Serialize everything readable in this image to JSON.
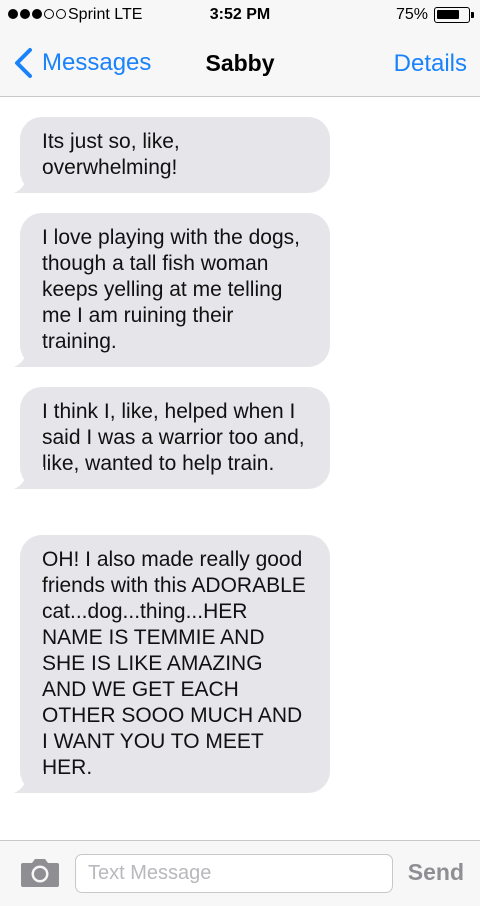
{
  "status_bar": {
    "signal_bars_filled": 3,
    "signal_bars_total": 5,
    "carrier": "Sprint  LTE",
    "time": "3:52 PM",
    "battery_percent_label": "75%",
    "battery_level": 0.75
  },
  "nav": {
    "back_label": "Messages",
    "title": "Sabby",
    "details_label": "Details"
  },
  "messages": [
    {
      "text": "Its just so, like, overwhelming!"
    },
    {
      "text": "I love playing with the dogs, though a tall fish woman keeps yelling at me telling me I am ruining their training."
    },
    {
      "text": "I think I, like, helped when I said I was a warrior too and, like, wanted to help train."
    },
    {
      "text": "OH! I also made really good friends with this ADORABLE cat...dog...thing...HER NAME IS TEMMIE AND SHE IS LIKE AMAZING AND WE GET EACH OTHER SOOO MUCH AND I WANT YOU TO MEET HER."
    }
  ],
  "input_bar": {
    "placeholder": "Text Message",
    "value": "",
    "send_label": "Send"
  },
  "colors": {
    "accent": "#1a82fb",
    "incoming_bubble": "#e5e5ea",
    "bar_background": "#f7f7f7",
    "send_disabled": "#8e8e93"
  },
  "icons": [
    "chevron-left-icon",
    "camera-icon",
    "battery-icon",
    "signal-dots-icon"
  ]
}
